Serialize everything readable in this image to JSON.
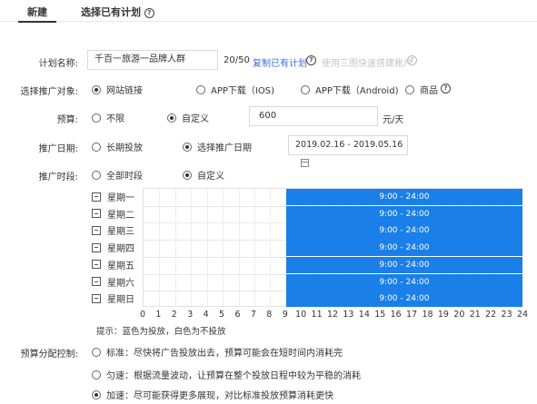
{
  "tabs": {
    "new": "新建",
    "copy_label": "选择已有计划",
    "help": "?"
  },
  "plan_name": {
    "label": "计划名称:",
    "value": "千百一旅游一品牌人群",
    "counter": "20/50",
    "copy_link": "复制已有计划",
    "help": "?",
    "assist_text": "使用三图快速搭建账户",
    "assist_help": "?"
  },
  "promo_target": {
    "label": "选择推广对象:",
    "options": [
      {
        "label": "网站链接",
        "checked": true
      },
      {
        "label": "APP下载（IOS)",
        "checked": false
      },
      {
        "label": "APP下载（Android)",
        "checked": false
      },
      {
        "label": "商品",
        "checked": false
      }
    ],
    "help": "?"
  },
  "budget": {
    "label": "预算:",
    "options": [
      {
        "label": "不限",
        "checked": false
      },
      {
        "label": "自定义",
        "checked": true
      }
    ],
    "value": "600",
    "unit": "元/天"
  },
  "promo_date": {
    "label": "推广日期:",
    "options": [
      {
        "label": "长期投放",
        "checked": false
      },
      {
        "label": "选择推广日期",
        "checked": true
      }
    ],
    "range": "2019.02.16 - 2019.05.16"
  },
  "promo_time": {
    "label": "推广时段:",
    "options": [
      {
        "label": "全部时段",
        "checked": false
      },
      {
        "label": "自定义",
        "checked": true
      }
    ]
  },
  "schedule": {
    "days": [
      "星期一",
      "星期二",
      "星期三",
      "星期四",
      "星期五",
      "星期六",
      "星期日"
    ],
    "active_start_hour": 9,
    "active_end_hour": 24,
    "slot_label": "9:00 - 24:00",
    "hours": [
      "0",
      "1",
      "2",
      "3",
      "4",
      "5",
      "6",
      "7",
      "8",
      "9",
      "10",
      "11",
      "12",
      "13",
      "14",
      "15",
      "16",
      "17",
      "18",
      "19",
      "20",
      "21",
      "22",
      "23",
      "24"
    ],
    "hint": "提示：蓝色为投放，白色为不投放",
    "colors": {
      "active": "#1a7fe8",
      "grid": "#e1e1e1"
    }
  },
  "budget_pacing": {
    "label": "预算分配控制:",
    "options": [
      {
        "label": "标准：尽快将广告投放出去，预算可能会在短时间内消耗完",
        "checked": false
      },
      {
        "label": "匀速：根据流量波动，让预算在整个投放日程中较为平稳的消耗",
        "checked": false
      },
      {
        "label": "加速：尽可能获得更多展现，对比标准投放预算消耗更快",
        "checked": true
      }
    ]
  }
}
